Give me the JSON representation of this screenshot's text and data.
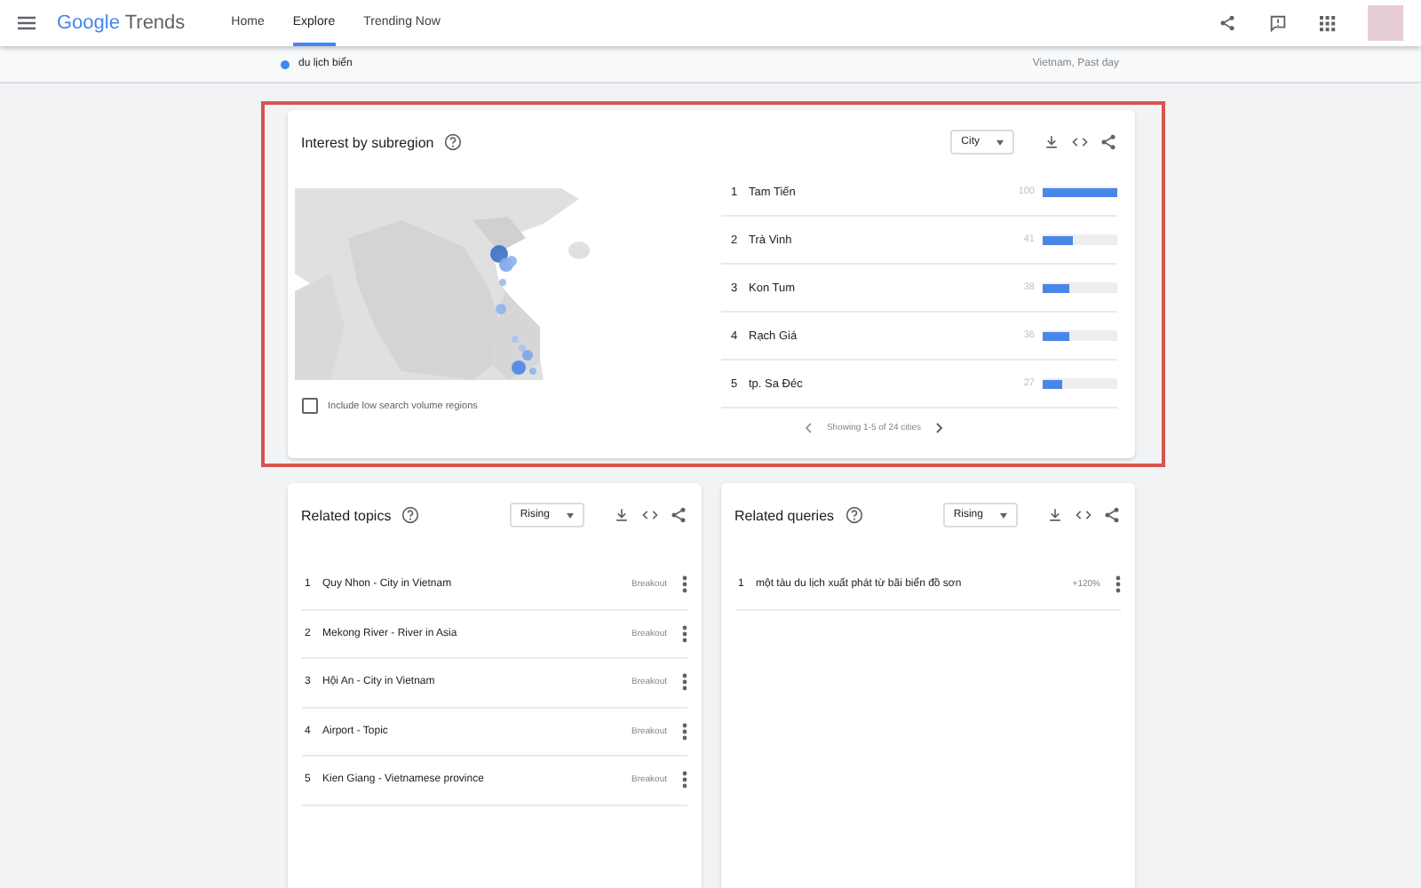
{
  "header": {
    "logo": {
      "first": "Google",
      "second": "Trends"
    },
    "nav": [
      {
        "label": "Home",
        "selected": false
      },
      {
        "label": "Explore",
        "selected": true
      },
      {
        "label": "Trending Now",
        "selected": false
      }
    ]
  },
  "search_term": {
    "term": "du lịch biển",
    "color": "#4285f4",
    "scope": "Vietnam, Past day"
  },
  "subregion": {
    "title": "Interest by subregion",
    "resolution": "City",
    "highlighted": true,
    "rows": [
      {
        "rank": "1",
        "name": "Tam Tiến",
        "value": "100",
        "level": 1.0
      },
      {
        "rank": "2",
        "name": "Trà Vinh",
        "value": "41",
        "level": 0.41
      },
      {
        "rank": "3",
        "name": "Kon Tum",
        "value": "38",
        "level": 0.38
      },
      {
        "rank": "4",
        "name": "Rạch Giá",
        "value": "36",
        "level": 0.36
      },
      {
        "rank": "5",
        "name": "tp. Sa Đéc",
        "value": "27",
        "level": 0.27
      }
    ],
    "pagination": "Showing 1-5 of 24 cities",
    "low_volume": {
      "label": "Include low search volume regions",
      "checked": false
    }
  },
  "related_topics": {
    "title": "Related topics",
    "filter": "Rising",
    "rows": [
      {
        "rank": "1",
        "name": "Quy Nhon - City in Vietnam",
        "value": "Breakout"
      },
      {
        "rank": "2",
        "name": "Mekong River - River in Asia",
        "value": "Breakout"
      },
      {
        "rank": "3",
        "name": "Hội An - City in Vietnam",
        "value": "Breakout"
      },
      {
        "rank": "4",
        "name": "Airport - Topic",
        "value": "Breakout"
      },
      {
        "rank": "5",
        "name": "Kien Giang - Vietnamese province",
        "value": "Breakout"
      }
    ]
  },
  "related_queries": {
    "title": "Related queries",
    "filter": "Rising",
    "rows": [
      {
        "rank": "1",
        "name": "một tàu du lịch xuất phát từ bãi biển đồ sơn",
        "value": "+120%"
      }
    ]
  }
}
